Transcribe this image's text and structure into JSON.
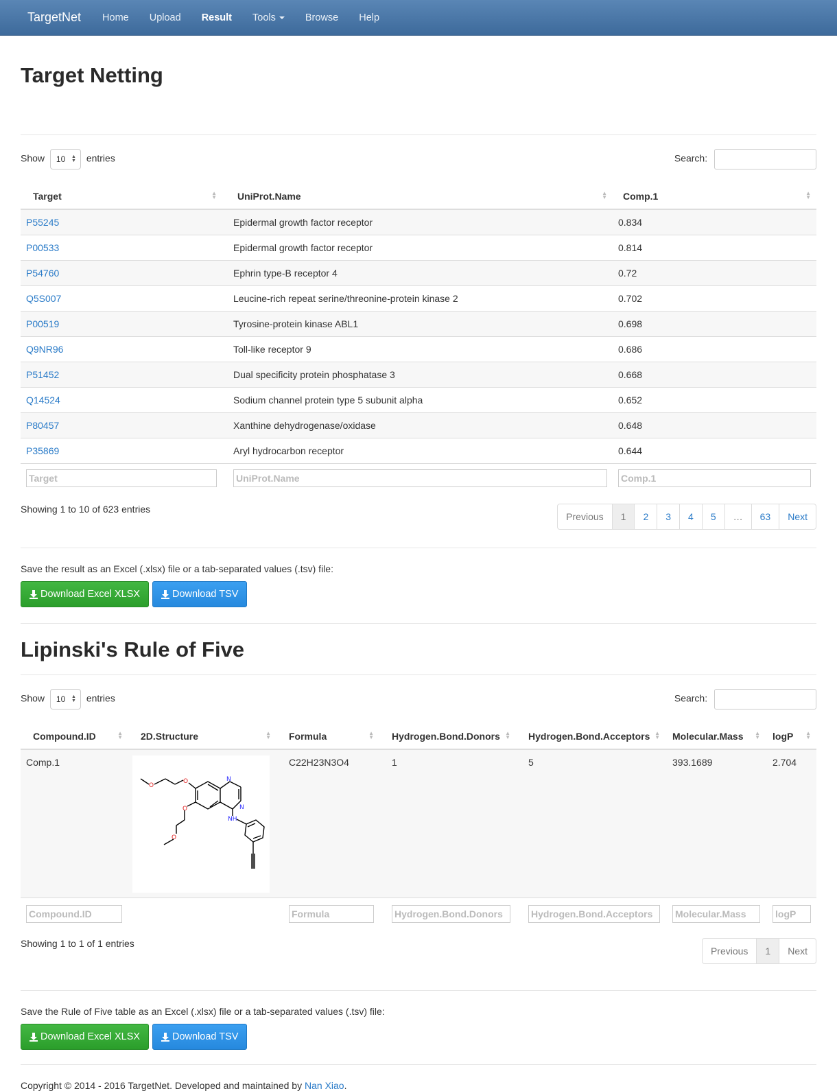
{
  "navbar": {
    "brand": "TargetNet",
    "items": [
      {
        "label": "Home"
      },
      {
        "label": "Upload"
      },
      {
        "label": "Result"
      },
      {
        "label": "Tools"
      },
      {
        "label": "Browse"
      },
      {
        "label": "Help"
      }
    ]
  },
  "section1": {
    "title": "Target Netting",
    "show_label": "Show",
    "entries_value": "10",
    "entries_label": "entries",
    "search_label": "Search:",
    "columns": [
      "Target",
      "UniProt.Name",
      "Comp.1"
    ],
    "rows": [
      [
        "P55245",
        "Epidermal growth factor receptor",
        "0.834"
      ],
      [
        "P00533",
        "Epidermal growth factor receptor",
        "0.814"
      ],
      [
        "P54760",
        "Ephrin type-B receptor 4",
        "0.72"
      ],
      [
        "Q5S007",
        "Leucine-rich repeat serine/threonine-protein kinase 2",
        "0.702"
      ],
      [
        "P00519",
        "Tyrosine-protein kinase ABL1",
        "0.698"
      ],
      [
        "Q9NR96",
        "Toll-like receptor 9",
        "0.686"
      ],
      [
        "P51452",
        "Dual specificity protein phosphatase 3",
        "0.668"
      ],
      [
        "Q14524",
        "Sodium channel protein type 5 subunit alpha",
        "0.652"
      ],
      [
        "P80457",
        "Xanthine dehydrogenase/oxidase",
        "0.648"
      ],
      [
        "P35869",
        "Aryl hydrocarbon receptor",
        "0.644"
      ]
    ],
    "filters": [
      "Target",
      "UniProt.Name",
      "Comp.1"
    ],
    "info": "Showing 1 to 10 of 623 entries",
    "pagination": [
      "Previous",
      "1",
      "2",
      "3",
      "4",
      "5",
      "…",
      "63",
      "Next"
    ],
    "save_text": "Save the result as an Excel (.xlsx) file or a tab-separated values (.tsv) file:",
    "btn_xlsx": "Download Excel XLSX",
    "btn_tsv": "Download TSV"
  },
  "section2": {
    "title": "Lipinski's Rule of Five",
    "show_label": "Show",
    "entries_value": "10",
    "entries_label": "entries",
    "search_label": "Search:",
    "columns": [
      "Compound.ID",
      "2D.Structure",
      "Formula",
      "Hydrogen.Bond.Donors",
      "Hydrogen.Bond.Acceptors",
      "Molecular.Mass",
      "logP"
    ],
    "row": {
      "id": "Comp.1",
      "formula": "C22H23N3O4",
      "donors": "1",
      "acceptors": "5",
      "mass": "393.1689",
      "logp": "2.704"
    },
    "structure_atoms": {
      "o": "O",
      "n": "N",
      "nh": "NH"
    },
    "filters": [
      "Compound.ID",
      "Formula",
      "Hydrogen.Bond.Donors",
      "Hydrogen.Bond.Acceptors",
      "Molecular.Mass",
      "logP"
    ],
    "info": "Showing 1 to 1 of 1 entries",
    "pagination": [
      "Previous",
      "1",
      "Next"
    ],
    "save_text": "Save the Rule of Five table as an Excel (.xlsx) file or a tab-separated values (.tsv) file:",
    "btn_xlsx": "Download Excel XLSX",
    "btn_tsv": "Download TSV"
  },
  "footer": {
    "text": "Copyright © 2014 - 2016 TargetNet. Developed and maintained by",
    "author": "Nan Xiao",
    "end": "."
  },
  "colors": {
    "link": "#2a7bc8",
    "green": "#2b9e2b",
    "blue": "#2689de",
    "navbar": "#4a77a8"
  }
}
